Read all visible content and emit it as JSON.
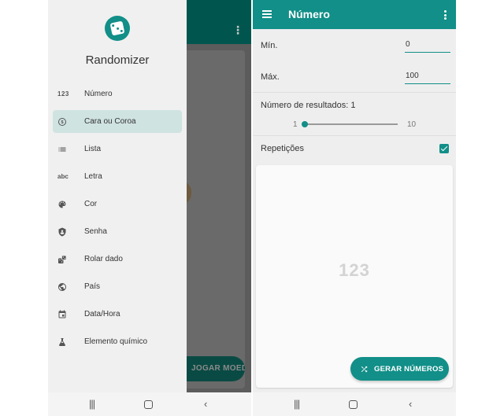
{
  "left_screen": {
    "background": {
      "fab_label": "JOGAR MOEDA"
    },
    "drawer": {
      "app_name": "Randomizer",
      "items": [
        {
          "icon": "numbers-icon",
          "glyph": "123",
          "label": "Número",
          "active": false
        },
        {
          "icon": "coin-icon",
          "glyph": "",
          "label": "Cara ou Coroa",
          "active": true
        },
        {
          "icon": "list-icon",
          "glyph": "",
          "label": "Lista",
          "active": false
        },
        {
          "icon": "text-abc-icon",
          "glyph": "abc",
          "label": "Letra",
          "active": false
        },
        {
          "icon": "palette-icon",
          "glyph": "",
          "label": "Cor",
          "active": false
        },
        {
          "icon": "shield-icon",
          "glyph": "",
          "label": "Senha",
          "active": false
        },
        {
          "icon": "dice-icon",
          "glyph": "",
          "label": "Rolar dado",
          "active": false
        },
        {
          "icon": "globe-icon",
          "glyph": "",
          "label": "País",
          "active": false
        },
        {
          "icon": "calendar-icon",
          "glyph": "",
          "label": "Data/Hora",
          "active": false
        },
        {
          "icon": "flask-icon",
          "glyph": "",
          "label": "Elemento químico",
          "active": false
        }
      ]
    }
  },
  "right_screen": {
    "title": "Número",
    "min": {
      "label": "Mín.",
      "value": "0"
    },
    "max": {
      "label": "Máx.",
      "value": "100"
    },
    "results": {
      "label": "Número de resultados: 1",
      "min_label": "1",
      "max_label": "10",
      "min": 1,
      "max": 10,
      "value": 1
    },
    "repetitions": {
      "label": "Repetições",
      "checked": true
    },
    "placeholder": "123",
    "fab_label": "GERAR NÚMEROS"
  },
  "colors": {
    "accent": "#118f88",
    "dark_appbar": "#00564e",
    "active_item": "#cfe3e1"
  }
}
